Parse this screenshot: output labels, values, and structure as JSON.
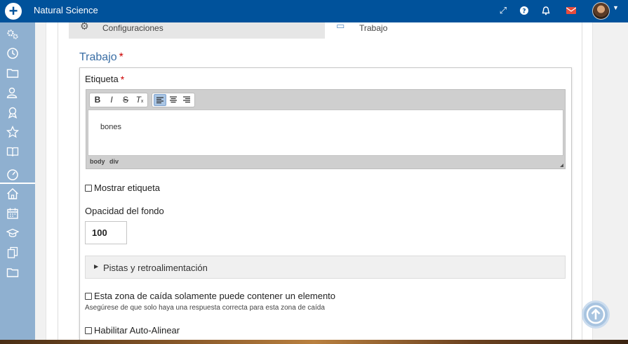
{
  "app": {
    "title": "Natural Science"
  },
  "tabs": [
    {
      "label": "Configuraciones",
      "icon": "gears-icon"
    },
    {
      "label": "Trabajo",
      "icon": "monitor-icon"
    }
  ],
  "section": {
    "title": "Trabajo",
    "required_mark": "*"
  },
  "label_field": {
    "label": "Etiqueta",
    "required_mark": "*",
    "content": "bones",
    "path": [
      "body",
      "div"
    ],
    "toolbar": [
      "B",
      "I",
      "S",
      "Tx",
      "align-left",
      "align-center",
      "align-right"
    ]
  },
  "show_label": {
    "label": "Mostrar etiqueta",
    "checked": false
  },
  "opacity": {
    "label": "Opacidad del fondo",
    "value": "100"
  },
  "hints": {
    "label": "Pistas y retroalimentación"
  },
  "single_element": {
    "label": "Esta zona de caída solamente puede contener un elemento",
    "help": "Asegúrese de que solo haya una respuesta correcta para esta zona de caída",
    "checked": false
  },
  "auto_align": {
    "label": "Habilitar Auto-Alinear",
    "checked": false
  },
  "colors": {
    "topbar": "#00529b",
    "sidebar": "#8fb0d0",
    "accent": "#3a6ea5",
    "required": "#cc0000"
  }
}
